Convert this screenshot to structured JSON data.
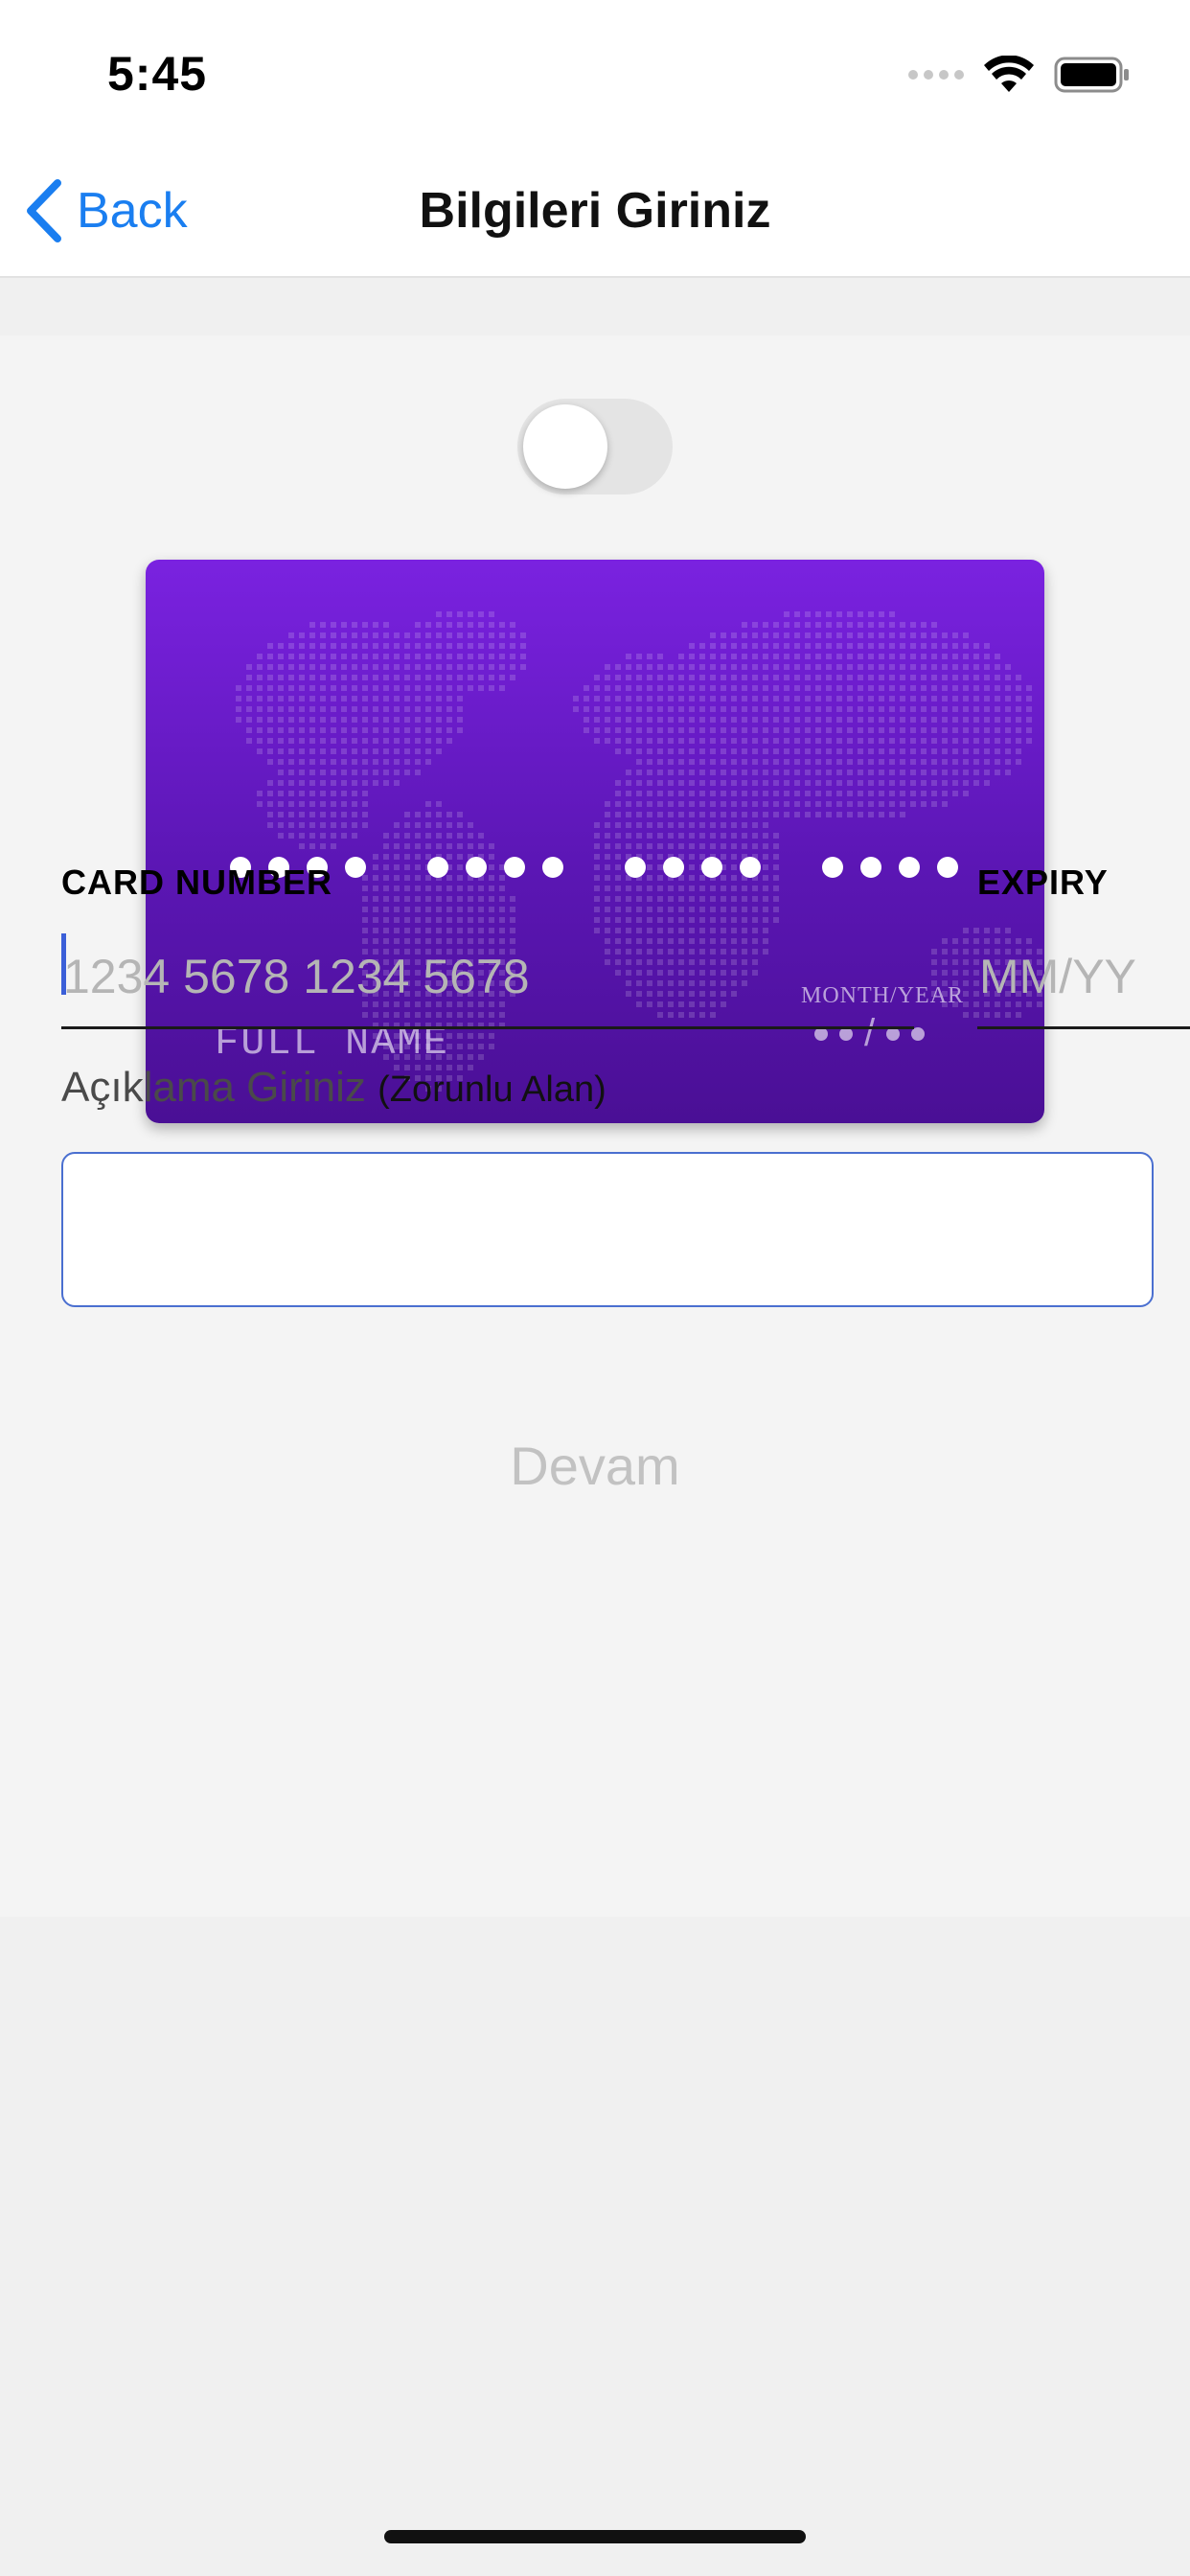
{
  "status_bar": {
    "time": "5:45"
  },
  "nav": {
    "back_label": "Back",
    "title": "Bilgileri Giriniz"
  },
  "card": {
    "name_placeholder": "FULL NAME",
    "expiry_label": "MONTH/YEAR",
    "expiry_separator": "/"
  },
  "form": {
    "card_number_label": "CARD NUMBER",
    "card_number_placeholder": "1234 5678 1234 5678",
    "expiry_label": "EXPIRY",
    "expiry_placeholder": "MM/YY",
    "description_label": "Açıklama Giriniz",
    "description_required": "(Zorunlu Alan)",
    "continue_label": "Devam"
  },
  "toggle": {
    "on": false
  },
  "colors": {
    "accent": "#1a7ef0",
    "card_top": "#7a22e0",
    "card_bottom": "#4a0f95",
    "input_focus": "#4a6fd0",
    "disabled_text": "#c2c2c2"
  },
  "icons": {
    "back": "chevron-left-icon",
    "signal": "signal-icon",
    "wifi": "wifi-icon",
    "battery": "battery-icon",
    "map": "world-map-icon"
  }
}
